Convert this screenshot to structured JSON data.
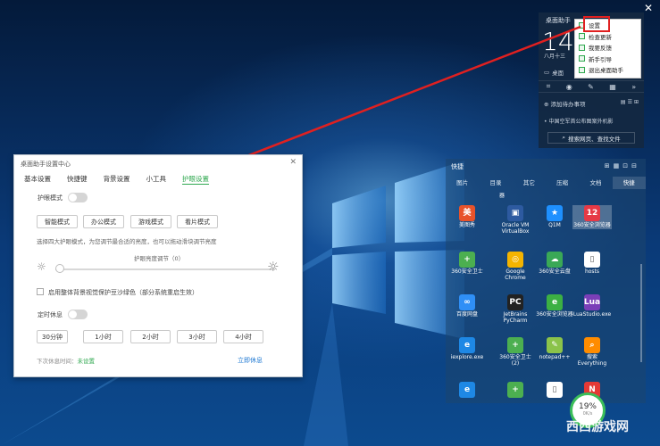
{
  "desktop": {
    "close_glyph": "✕"
  },
  "widget": {
    "title": "桌面助手",
    "time": "14",
    "date": "八月十三",
    "desk_label": "桌面",
    "toolbar_icons": [
      "crop-icon",
      "eye-icon",
      "edit-icon",
      "calendar-icon",
      "more-icon"
    ],
    "todo_label": "添加待办事项",
    "news": "中国空军首公布图案外机影",
    "search_label": "搜索网页、查找文件"
  },
  "context_menu": {
    "items": [
      "设置",
      "检查更新",
      "我要反馈",
      "新手引导",
      "退出桌面助手"
    ],
    "highlighted": "设置",
    "accent": "#e02020"
  },
  "dialog": {
    "title": "桌面助手设置中心",
    "close_glyph": "✕",
    "tabs": [
      "基本设置",
      "快捷键",
      "背景设置",
      "小工具",
      "护眼设置"
    ],
    "active_tab": "护眼设置",
    "eye_mode": {
      "label": "护眼模式",
      "enabled": false,
      "buttons": [
        "智能模式",
        "办公模式",
        "游戏模式",
        "看片模式"
      ],
      "hint": "选择四大护眼模式，为您调节最合适的亮度，也可以拖动滑块调节亮度",
      "slider_label": "护眼亮度调节（0）",
      "slider_value": 0,
      "checkbox_label": "启用整体背景视觉保护豆沙绿色（部分系统重启生效）",
      "checkbox_checked": false
    },
    "rest": {
      "label": "定时休息",
      "enabled": false,
      "buttons": [
        "30分钟",
        "1小时",
        "2小时",
        "3小时",
        "4小时"
      ],
      "next_label": "下次休息时间：",
      "next_value": "未设置",
      "rest_now": "立即休息"
    },
    "accent": "#2fa84f"
  },
  "panel": {
    "title": "快捷",
    "tabs": [
      "图片",
      "目录",
      "其它",
      "压缩",
      "文档",
      "快捷"
    ],
    "active_tab": "快捷",
    "sub_text": "器",
    "apps": [
      {
        "label": "美图秀",
        "icon": "meitu-icon",
        "color": "#e8532b"
      },
      {
        "label": "Oracle VM VirtualBox",
        "icon": "virtualbox-icon",
        "color": "#2d5aa0"
      },
      {
        "label": "Q1M",
        "icon": "star-icon",
        "color": "#1e90ff"
      },
      {
        "label": "360安全浏览器",
        "icon": "calendar-icon",
        "color": "#e63946"
      },
      {
        "label": "360安全卫士",
        "icon": "shield-plus-icon",
        "color": "#4caf50"
      },
      {
        "label": "Google Chrome",
        "icon": "chrome-icon",
        "color": "#f4b400"
      },
      {
        "label": "360安全云盘",
        "icon": "cloud-icon",
        "color": "#3aa856"
      },
      {
        "label": "hosts",
        "icon": "file-icon",
        "color": "#ffffff"
      },
      {
        "label": "百度网盘",
        "icon": "baidu-icon",
        "color": "#2f8ff6"
      },
      {
        "label": "JetBrains PyCharm",
        "icon": "pycharm-icon",
        "color": "#222222"
      },
      {
        "label": "360安全浏览器",
        "icon": "browser-icon",
        "color": "#3cb043"
      },
      {
        "label": "LuaStudio.exe",
        "icon": "lua-icon",
        "color": "#7b3fb8"
      },
      {
        "label": "iexplore.exe",
        "icon": "ie-icon",
        "color": "#1e88e5"
      },
      {
        "label": "360安全卫士 (2)",
        "icon": "shield-plus-icon",
        "color": "#4caf50"
      },
      {
        "label": "notepad++",
        "icon": "notepad-icon",
        "color": "#8bc34a"
      },
      {
        "label": "搜索 Everything",
        "icon": "search-icon",
        "color": "#ff8c00"
      },
      {
        "label": "",
        "icon": "ie-icon",
        "color": "#1e88e5"
      },
      {
        "label": "",
        "icon": "shield-plus-icon",
        "color": "#4caf50"
      },
      {
        "label": "",
        "icon": "file-icon",
        "color": "#ffffff"
      },
      {
        "label": "",
        "icon": "n-icon",
        "color": "#e53935"
      }
    ]
  },
  "gauge": {
    "percent": "19%",
    "sub": "0K/s"
  },
  "watermark": "西西游戏网"
}
